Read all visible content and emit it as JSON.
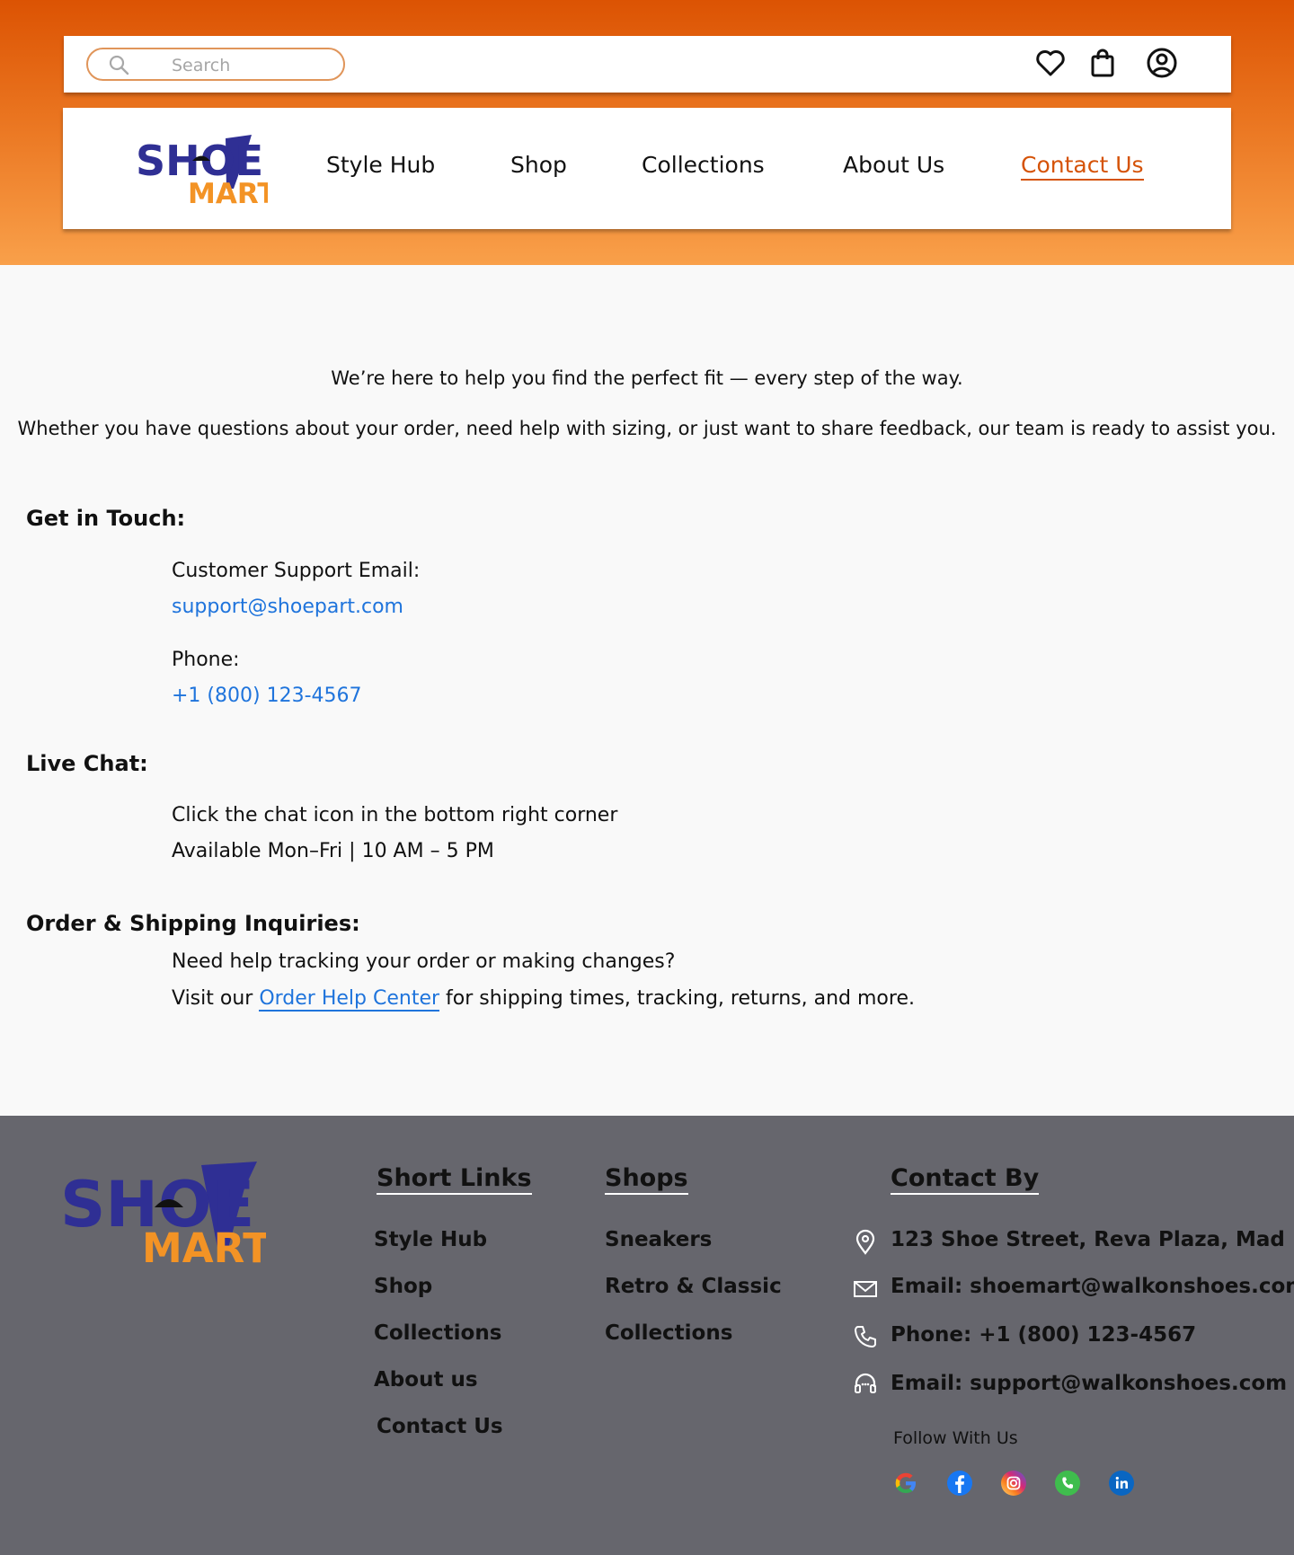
{
  "search": {
    "placeholder": "Search"
  },
  "top_icons": [
    "heart-icon",
    "shopping-bag-icon",
    "user-account-icon"
  ],
  "brand": {
    "line1": "SHOE",
    "line2": "MART",
    "colors": {
      "blue": "#2f2f94",
      "orange": "#f39325"
    }
  },
  "nav": {
    "items": [
      "Style Hub",
      "Shop",
      "Collections",
      "About Us",
      "Contact Us"
    ],
    "active": "Contact Us"
  },
  "intro": {
    "line1": "We’re here to help you find the perfect fit — every step of the way.",
    "line2": "Whether you have questions about your order, need help with sizing, or just want to share feedback, our team is ready to assist you."
  },
  "get_in_touch": {
    "heading": "Get in Touch:",
    "email_label": "Customer Support Email:",
    "email": "support@shoepart.com",
    "phone_label": "Phone:",
    "phone": "+1 (800) 123-4567"
  },
  "live_chat": {
    "heading": "Live Chat:",
    "line1": "Click the chat icon in the bottom right corner",
    "line2": "Available Mon–Fri | 10 AM – 5 PM"
  },
  "order": {
    "heading": "Order & Shipping Inquiries:",
    "line1": "Need help tracking your order or making changes?",
    "prefix": "Visit our",
    "link": "Order Help Center",
    "suffix": "for shipping times, tracking, returns, and more."
  },
  "footer": {
    "short_links": {
      "heading": "Short Links",
      "items": [
        "Style Hub",
        "Shop",
        "Collections",
        "About us",
        "Contact Us"
      ]
    },
    "shops": {
      "heading": "Shops",
      "items": [
        "Sneakers",
        "Retro & Classic",
        "Collections"
      ]
    },
    "contact": {
      "heading": "Contact By",
      "address": "123 Shoe Street, Reva Plaza, Mad",
      "email": "Email: shoemart@walkonshoes.com",
      "phone": "Phone: +1 (800) 123-4567",
      "support": "Email: support@walkonshoes.com"
    },
    "follow": "Follow With Us",
    "social": [
      "google-icon",
      "facebook-icon",
      "instagram-icon",
      "whatsapp-icon",
      "linkedin-icon"
    ]
  },
  "colors": {
    "accent": "#d55308",
    "link": "#1f74dc",
    "footer_bg": "#66666d"
  }
}
